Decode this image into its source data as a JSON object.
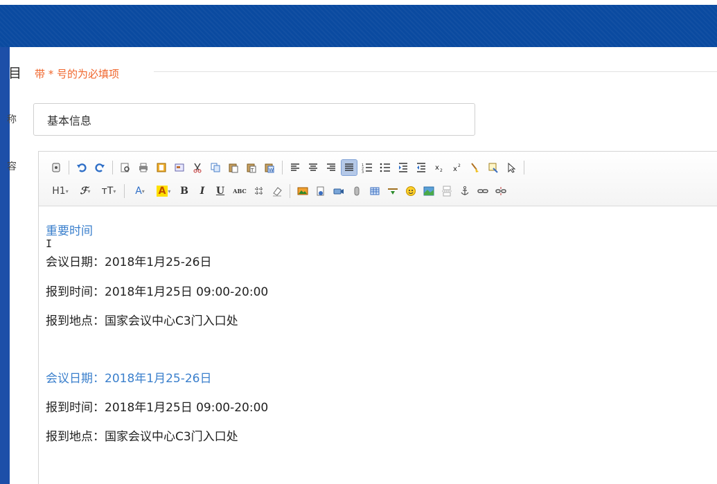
{
  "form": {
    "section_glyph": "目",
    "required_note": "带 * 号的为必填项",
    "name_label": "称",
    "content_label": "容",
    "name_value": "基本信息"
  },
  "toolbar": {
    "row2_text": {
      "heading": "H1",
      "font_family": "ℱ",
      "font_size": "тT",
      "font_color": "A",
      "bg_color": "A",
      "bold": "B",
      "italic": "I",
      "underline": "U",
      "strike": "ABC"
    }
  },
  "editor": {
    "paragraphs": [
      {
        "text": "重要时间",
        "style": "blue"
      },
      {
        "text": "会议日期：2018年1月25-26日",
        "style": "normal"
      },
      {
        "text": "报到时间：2018年1月25日 09:00-20:00",
        "style": "normal"
      },
      {
        "text": "报到地点：国家会议中心C3门入口处",
        "style": "normal"
      },
      {
        "text": "会议日期：2018年1月25-26日",
        "style": "blue"
      },
      {
        "text": "报到时间：2018年1月25日 09:00-20:00",
        "style": "normal"
      },
      {
        "text": "报到地点：国家会议中心C3门入口处",
        "style": "normal"
      }
    ]
  },
  "colors": {
    "header_blue": "#0a4aa0",
    "required_orange": "#f0662c",
    "link_blue": "#3a7fcc"
  }
}
